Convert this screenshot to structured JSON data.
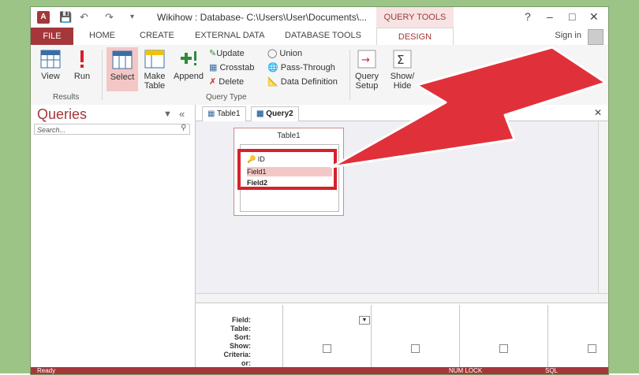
{
  "window": {
    "app_icon_text": "A",
    "title": "Wikihow : Database- C:\\Users\\User\\Documents\\...",
    "context_header": "QUERY TOOLS",
    "help": "?",
    "minimize": "–",
    "maximize": "□",
    "close": "✕"
  },
  "tabs": {
    "file": "FILE",
    "home": "HOME",
    "create": "CREATE",
    "external_data": "EXTERNAL DATA",
    "database_tools": "DATABASE TOOLS",
    "design": "DESIGN",
    "sign_in": "Sign in"
  },
  "ribbon": {
    "view": "View",
    "run": "Run",
    "select": "Select",
    "make_table_1": "Make",
    "make_table_2": "Table",
    "append": "Append",
    "update": "Update",
    "crosstab": "Crosstab",
    "delete": "Delete",
    "union": "Union",
    "pass_through": "Pass-Through",
    "data_definition": "Data Definition",
    "query_setup_1": "Query",
    "query_setup_2": "Setup",
    "show_hide_1": "Show/",
    "show_hide_2": "Hide",
    "group_results": "Results",
    "group_query_type": "Query Type"
  },
  "nav": {
    "title": "Queries",
    "search_placeholder": "Search..."
  },
  "doc_tabs": [
    "Table1",
    "Query2"
  ],
  "table_box": {
    "title": "Table1",
    "fields": [
      "ID",
      "Field1",
      "Field2"
    ]
  },
  "grid": {
    "rows": [
      "Field:",
      "Table:",
      "Sort:",
      "Show:",
      "Criteria:",
      "or:"
    ]
  },
  "status": {
    "left": "Ready",
    "num_lock": "NUM LOCK",
    "sql": "SQL"
  },
  "colors": {
    "access_accent": "#a4373a",
    "arrow_fill": "#e0313b",
    "highlight": "#d6212c"
  }
}
